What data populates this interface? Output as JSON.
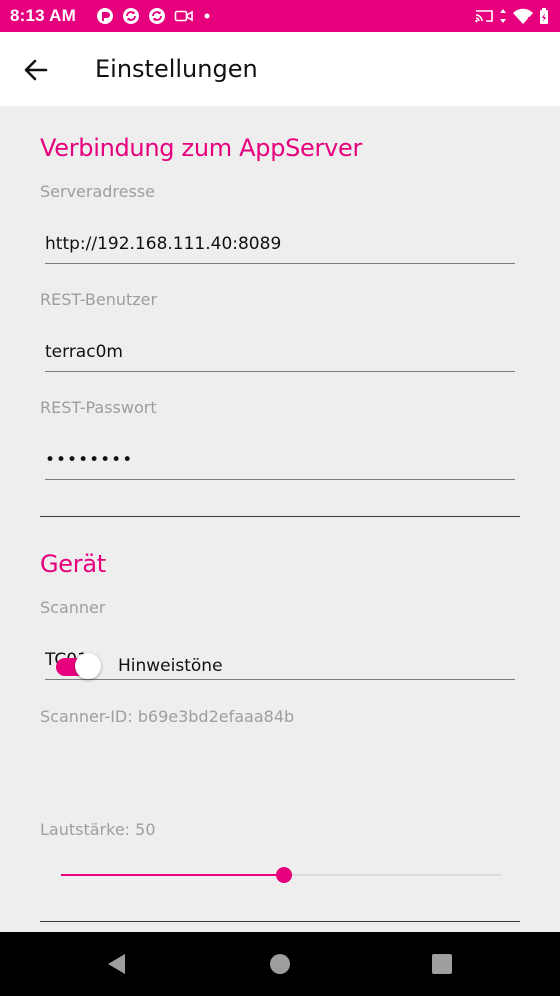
{
  "status_bar": {
    "time": "8:13 AM",
    "left_icons": [
      "notification-app-icon",
      "sync-icon",
      "sync-icon",
      "video-icon",
      "dot-icon"
    ],
    "right_icons": [
      "cast-icon",
      "data-arrows-icon",
      "wifi-icon",
      "battery-charging-icon"
    ]
  },
  "app_bar": {
    "back_icon": "arrow-left-icon",
    "title": "Einstellungen"
  },
  "sections": {
    "connection": {
      "title": "Verbindung zum AppServer",
      "server_label": "Serveradresse",
      "server_value": "http://192.168.111.40:8089",
      "user_label": "REST-Benutzer",
      "user_value": "terrac0m",
      "password_label": "REST-Passwort",
      "password_value": "••••••••"
    },
    "device": {
      "title": "Gerät",
      "scanner_label": "Scanner",
      "scanner_value": "TC01",
      "scanner_id": "Scanner-ID: b69e3bd2efaaa84b",
      "sound_toggle_label": "Hinweistöne",
      "sound_toggle_on": true,
      "volume_label": "Lautstärke: 50",
      "volume_value": 50,
      "volume_max": 100
    }
  },
  "colors": {
    "accent": "#e6007e",
    "background": "#eeeeee",
    "appbar": "#ffffff",
    "navbar": "#000000"
  },
  "nav_bar": {
    "icons": [
      "back-triangle-icon",
      "home-circle-icon",
      "recents-square-icon"
    ]
  }
}
